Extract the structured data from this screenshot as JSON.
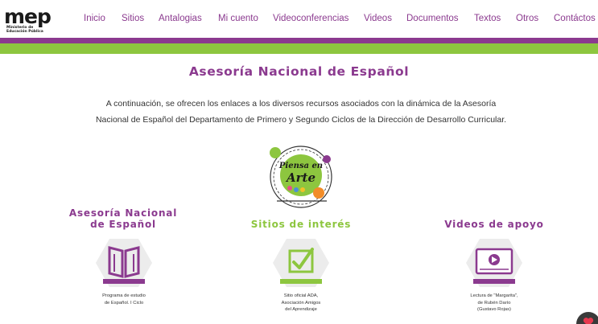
{
  "header": {
    "logo_text": "mep",
    "logo_sub": "Ministerio de Educación Pública",
    "nav": [
      {
        "label": "Inicio"
      },
      {
        "label": "Sitios"
      },
      {
        "label": "Antalogias"
      },
      {
        "label": "Mi cuento"
      },
      {
        "label": "Videoconferencias"
      },
      {
        "label": "Videos"
      },
      {
        "label": "Documentos"
      },
      {
        "label": "Textos"
      },
      {
        "label": "Otros"
      },
      {
        "label": "Contáctos"
      }
    ]
  },
  "colors": {
    "brand_purple": "#8b3a8f",
    "brand_green": "#8dc63f"
  },
  "main": {
    "title": "Asesoría Nacional de Español",
    "intro_line1": "A continuación, se ofrecen los enlaces a los diversos recursos asociados con la dinámica de la Asesoría",
    "intro_line2": "Nacional de Español del Departamento de Primero y Segundo Ciclos de la Dirección de Desarrollo Curricular.",
    "badge": {
      "line1": "Piensa en",
      "line2": "Arte"
    },
    "sections": [
      {
        "title_line1": "Asesoría Nacional",
        "title_line2": "de Español",
        "icon": "book-icon",
        "caption_line1": "Programa de estudio",
        "caption_line2": "de Español. I Ciclo"
      },
      {
        "title_line1": "Sitios de interés",
        "icon": "checkbox-icon",
        "caption_line1": "Sitio oficial ADA,",
        "caption_line2": "Asociación Amigos",
        "caption_line3": "del Aprendizaje"
      },
      {
        "title_line1": "Videos de apoyo",
        "icon": "video-player-icon",
        "caption_line1": "Lectura de \"Margarita\",",
        "caption_line2": "de Rubén Darío",
        "caption_line3": "(Gustavo Rojas)"
      }
    ]
  },
  "floating": {
    "icon": "heart-icon"
  }
}
